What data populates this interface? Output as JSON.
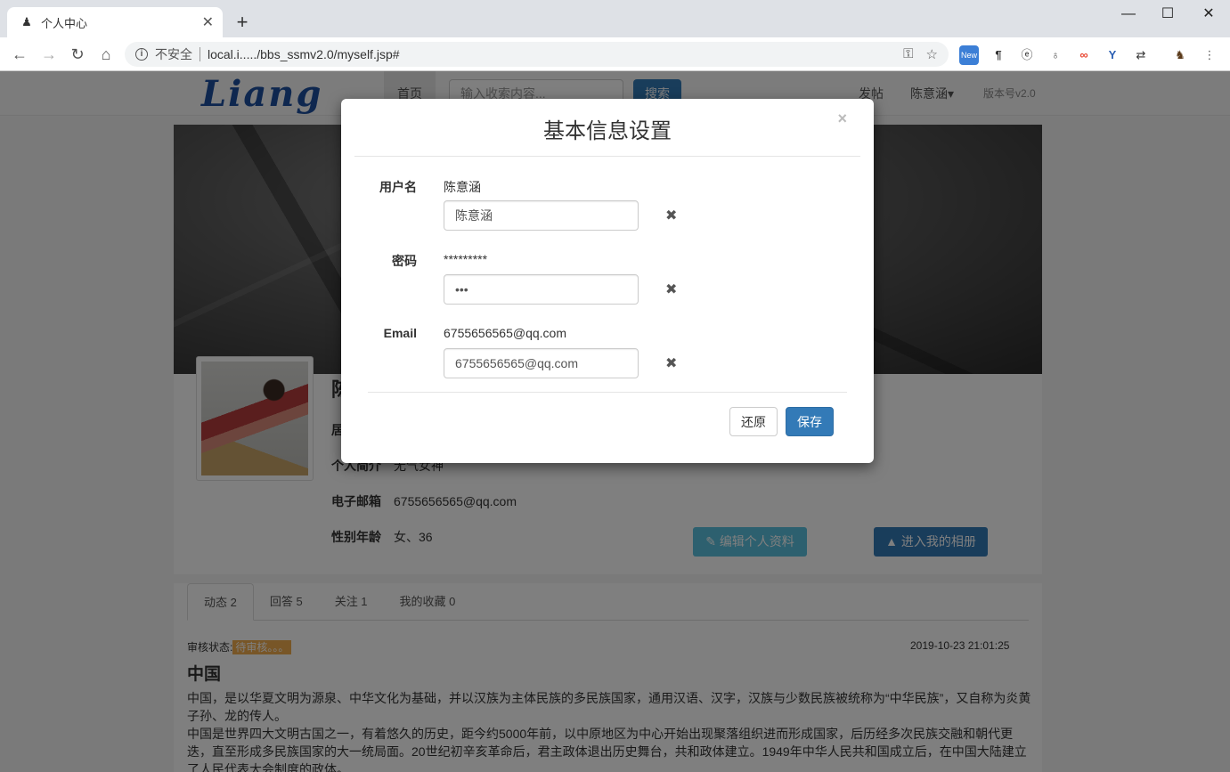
{
  "browser": {
    "tab_title": "个人中心",
    "tab_favicon": "user-favicon",
    "new_tab": "+",
    "insecure_label": "不安全",
    "url": "local.i...../bbs_ssmv2.0/myself.jsp#",
    "window_controls": [
      "—",
      "☐",
      "✕"
    ]
  },
  "site_nav": {
    "logo": "Liang",
    "home": "首页",
    "search_placeholder": "输入收索内容...",
    "search_button": "搜索",
    "post_link": "发帖",
    "user_menu": "陈意涵▾",
    "version": "版本号v2.0"
  },
  "profile": {
    "name": "陈",
    "residence_label": "居",
    "intro_label": "个人简介",
    "intro_value": "无气女神",
    "email_label": "电子邮箱",
    "email_value": "6755656565@qq.com",
    "gender_age_label": "性别年龄",
    "gender_age_value": "女、36",
    "edit_button": "编辑个人资料",
    "album_button": "进入我的相册"
  },
  "feed": {
    "tabs": [
      {
        "label": "动态 2"
      },
      {
        "label": "回答 5"
      },
      {
        "label": "关注 1"
      },
      {
        "label": "我的收藏 0"
      }
    ],
    "post": {
      "status_label": "审核状态:",
      "status_value": "待审核。。。",
      "time": "2019-10-23 21:01:25",
      "title": "中国",
      "paragraph1": "中国，是以华夏文明为源泉、中华文化为基础，并以汉族为主体民族的多民族国家，通用汉语、汉字，汉族与少数民族被统称为“中华民族”，又自称为炎黄子孙、龙的传人。",
      "paragraph2": "中国是世界四大文明古国之一，有着悠久的历史，距今约5000年前，以中原地区为中心开始出现聚落组织进而形成国家，后历经多次民族交融和朝代更迭，直至形成多民族国家的大一统局面。20世纪初辛亥革命后，君主政体退出历史舞台，共和政体建立。1949年中华人民共和国成立后，在中国大陆建立了人民代表大会制度的政体。"
    }
  },
  "modal": {
    "title": "基本信息设置",
    "close": "×",
    "fields": [
      {
        "label": "用户名",
        "current": "陈意涵",
        "value": "陈意涵"
      },
      {
        "label": "密码",
        "current": "*********",
        "value": "•••"
      },
      {
        "label": "Email",
        "current": "6755656565@qq.com",
        "value": "6755656565@qq.com"
      }
    ],
    "clear_icon": "✖",
    "reset_button": "还原",
    "save_button": "保存"
  },
  "colors": {
    "primary": "#337ab7",
    "info": "#5bc0de",
    "warning": "#f0ad4e"
  }
}
